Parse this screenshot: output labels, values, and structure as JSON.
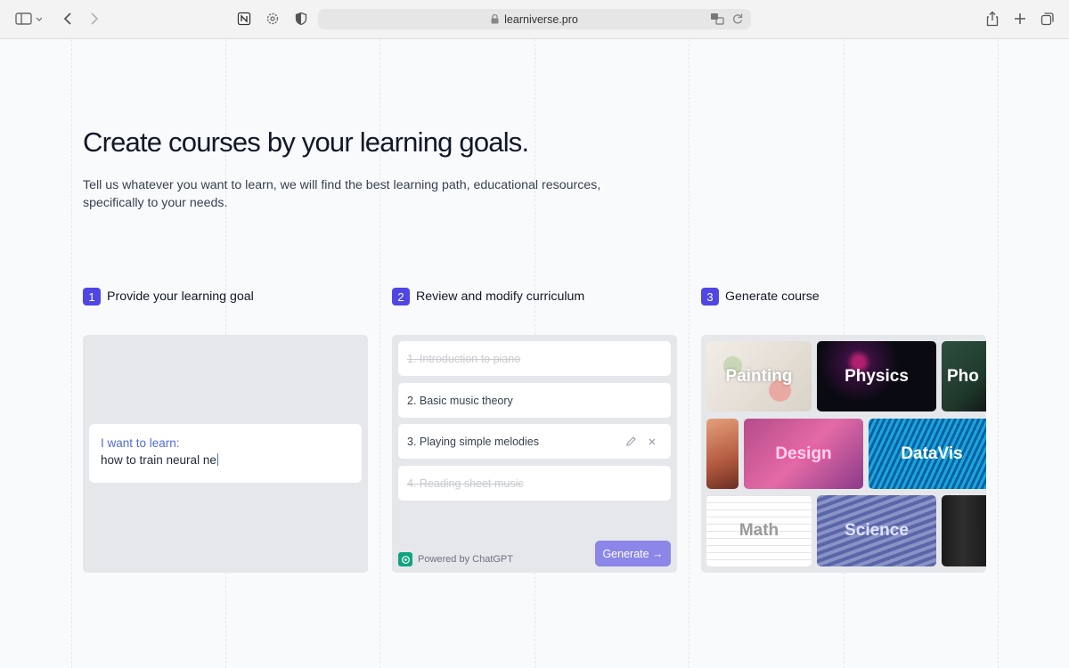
{
  "browser": {
    "url": "learniverse.pro"
  },
  "hero": {
    "title": "Create courses by your learning goals.",
    "subtitle": "Tell us whatever you want to learn, we will find the best learning path, educational resources, specifically to your needs."
  },
  "steps": [
    {
      "number": "1",
      "label": "Provide your learning goal"
    },
    {
      "number": "2",
      "label": "Review and modify curriculum"
    },
    {
      "number": "3",
      "label": "Generate course"
    }
  ],
  "goal_panel": {
    "label": "I want to learn:",
    "value": "how to train neural ne"
  },
  "curriculum": {
    "items": [
      {
        "text": "1. Introduction to piano",
        "state": "removed"
      },
      {
        "text": "2. Basic music theory",
        "state": "normal"
      },
      {
        "text": "3. Playing simple melodies",
        "state": "hovered"
      },
      {
        "text": "4. Reading sheet music",
        "state": "removed"
      }
    ],
    "powered_by": "Powered by ChatGPT",
    "generate_label": "Generate →"
  },
  "courses": {
    "tiles": [
      {
        "label": "Painting"
      },
      {
        "label": "Physics"
      },
      {
        "label": "Pho"
      },
      {
        "label": ""
      },
      {
        "label": "Design"
      },
      {
        "label": "DataVis"
      },
      {
        "label": "Math"
      },
      {
        "label": "Science"
      },
      {
        "label": ""
      }
    ]
  },
  "colors": {
    "accent": "#4f46e5",
    "generate_button": "#8b86e8",
    "panel_bg": "#e5e7eb",
    "goal_label": "#4f6bd8"
  }
}
